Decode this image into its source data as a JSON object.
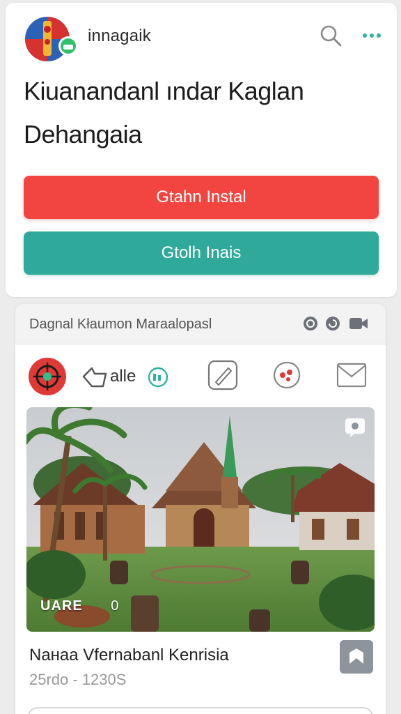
{
  "header": {
    "app_name": "innagaik",
    "title": "Kiuanandanl ındar Kaglan Dehangaia"
  },
  "buttons": {
    "primary_label": "Gtahn Instal",
    "secondary_label": "Gtolh Inais"
  },
  "post": {
    "header_title": "Dagnal Kłaumon Maraalopasl",
    "like_label": "alle",
    "photo_badge": "UARE",
    "photo_badge_extra": "0",
    "item_title": "Naнaa Vfernabanl Kenrisia",
    "item_meta": "25rdo - 1230S"
  },
  "icons": {
    "header": [
      "search-icon",
      "more-icon"
    ],
    "post_header": [
      "globe-icon",
      "refresh-icon",
      "video-icon"
    ],
    "actions": [
      "avatar-icon",
      "like-icon",
      "edit-icon",
      "sticker-icon",
      "mail-icon"
    ]
  },
  "colors": {
    "primary_red": "#f2453f",
    "teal": "#2fa99a",
    "accent_teal": "#2bb3a0"
  }
}
